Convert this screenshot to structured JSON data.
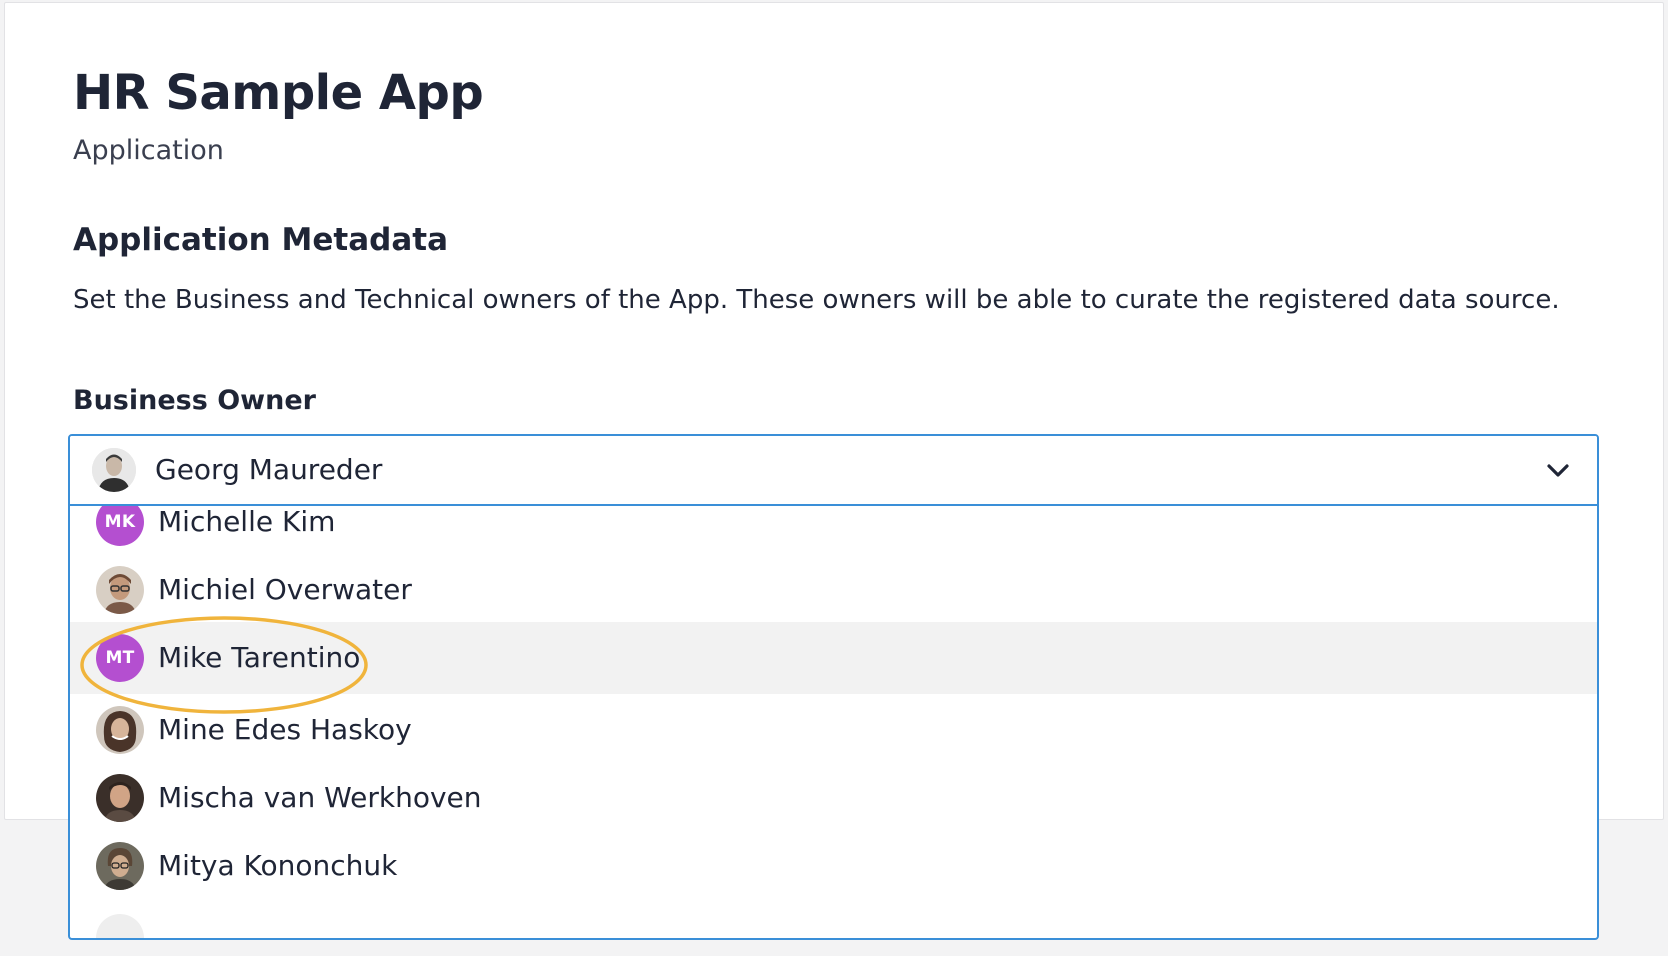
{
  "header": {
    "title": "HR Sample App",
    "subtitle": "Application"
  },
  "metadata": {
    "title": "Application Metadata",
    "description": "Set the Business and Technical owners of the App. These owners will be able to curate the registered data source."
  },
  "business_owner": {
    "label": "Business Owner",
    "selected": "Georg Maureder",
    "options": [
      {
        "name": "Michelle Kim",
        "initials": "MK",
        "avatar": "initials-avatar",
        "color": "#b44fd0"
      },
      {
        "name": "Michiel Overwater",
        "initials": "",
        "avatar": "photo-avatar",
        "color": "#8a6a55"
      },
      {
        "name": "Mike Tarentino",
        "initials": "MT",
        "avatar": "initials-avatar",
        "color": "#b44fd0",
        "highlighted": true
      },
      {
        "name": "Mine Edes Haskoy",
        "initials": "",
        "avatar": "photo-avatar",
        "color": "#6b5446"
      },
      {
        "name": "Mischa van Werkhoven",
        "initials": "",
        "avatar": "photo-avatar",
        "color": "#5b4a3f"
      },
      {
        "name": "Mitya Kononchuk",
        "initials": "",
        "avatar": "photo-avatar",
        "color": "#4c4a42"
      }
    ]
  },
  "colors": {
    "accent": "#3a8fd8",
    "annotation": "#f0b43c",
    "initials_bg": "#b44fd0",
    "highlight_row": "#f2f2f2"
  }
}
